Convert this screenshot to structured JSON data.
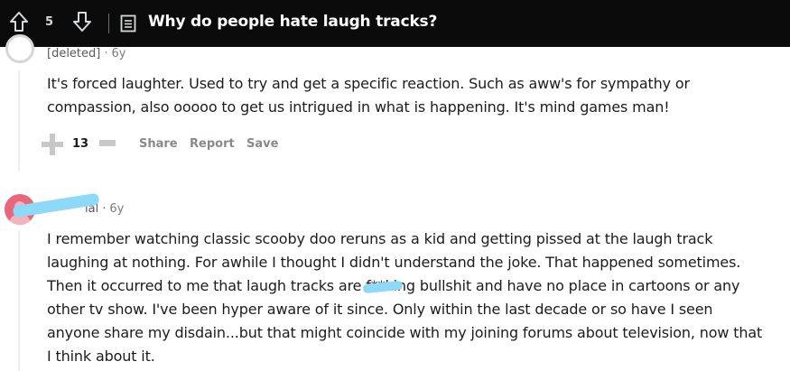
{
  "post": {
    "score": "5",
    "title": "Why do people hate laugh tracks?"
  },
  "comments": [
    {
      "author": "[deleted]",
      "age": "6y",
      "text": "It's forced laughter. Used to try and get a specific reaction. Such as aww's for sympathy or compassion, also ooooo to get us intrigued in what is happening. It's mind games man!",
      "score": "13",
      "actions": [
        "Share",
        "Report",
        "Save"
      ]
    },
    {
      "author": "ial",
      "age": "6y",
      "text_lines": [
        "I remember watching classic scooby doo reruns as a kid and getting pissed at the laugh track",
        "laughing at nothing. For awhile I thought I didn't understand the joke. That happened sometimes.",
        "Then it occurred to me that laugh tracks are f**king bullshit and have no place in cartoons or any",
        "other tv show. I've been hyper aware of it since. Only within the last decade or so have I seen",
        "anyone share my disdain...but that might coincide with my joining forums about television, now that",
        "I think about it."
      ]
    }
  ],
  "colors": {
    "topbar_bg": "#0b0b0b",
    "redaction": "#8ed8f8",
    "avatar": "#e8677a"
  },
  "icons": [
    "upvote-arrow-icon",
    "downvote-arrow-icon",
    "post-icon"
  ]
}
